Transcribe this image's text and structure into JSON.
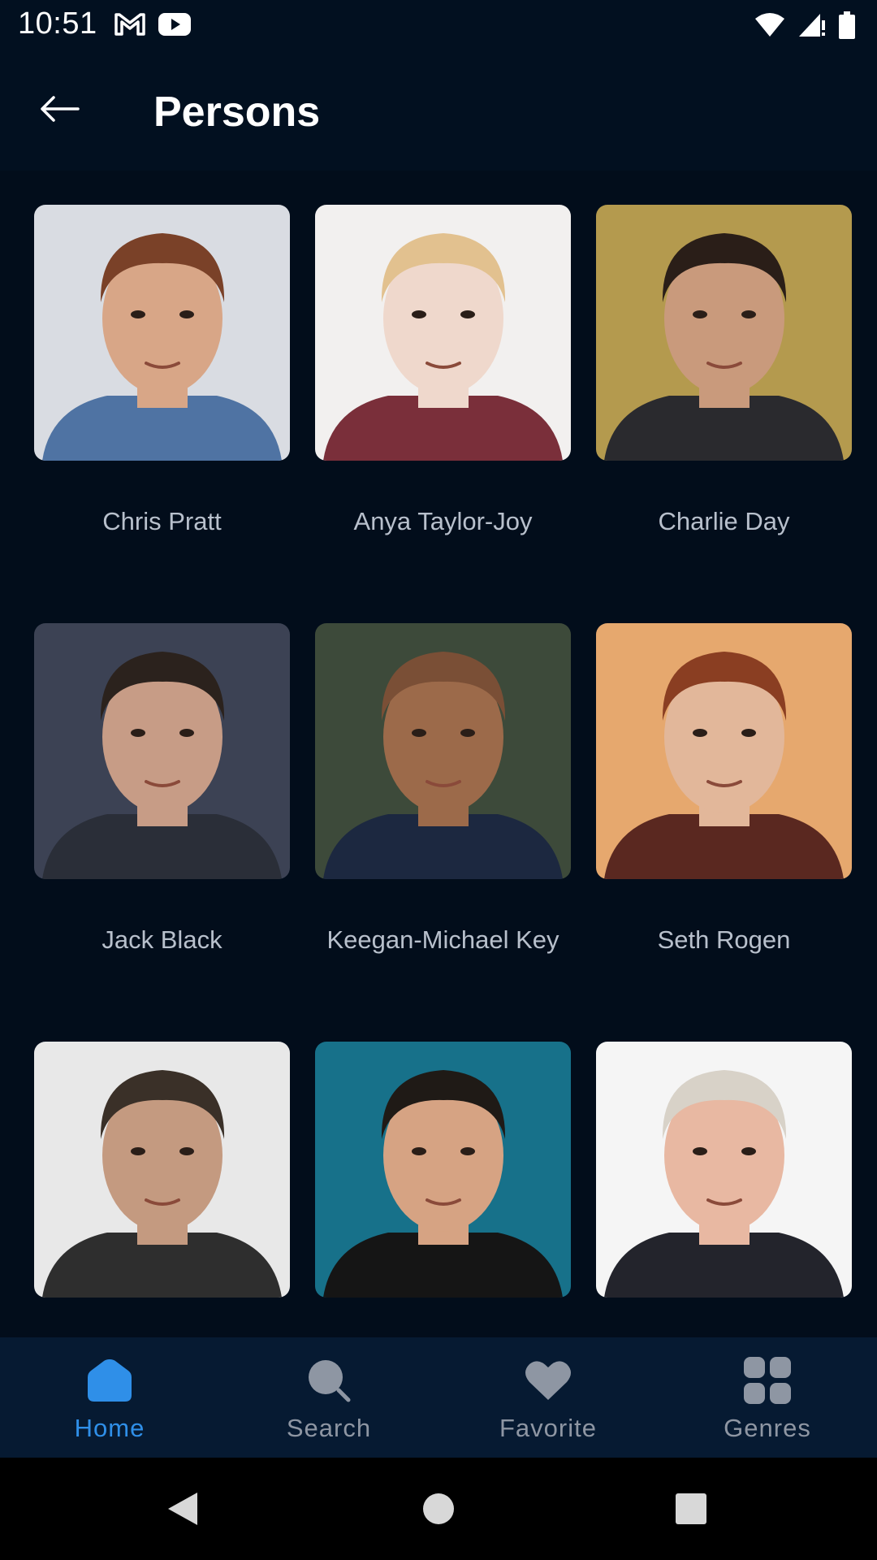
{
  "status_bar": {
    "time": "10:51",
    "left_icons": [
      "gmail-icon",
      "youtube-icon"
    ],
    "right_icons": [
      "wifi-icon",
      "signal-icon",
      "battery-icon"
    ]
  },
  "app_bar": {
    "title": "Persons",
    "back_icon": "arrow-left-icon"
  },
  "persons": [
    {
      "name": "Chris Pratt",
      "bg": "#d9dce2",
      "skin": "#d8a687",
      "hair": "#7a4128",
      "shirt": "#4f73a3"
    },
    {
      "name": "Anya Taylor-Joy",
      "bg": "#f2f0ef",
      "skin": "#efd8cc",
      "hair": "#e2c18f",
      "shirt": "#7a2f3a"
    },
    {
      "name": "Charlie Day",
      "bg": "#b49a4e",
      "skin": "#c99a7c",
      "hair": "#2a1e18",
      "shirt": "#2a2a2e"
    },
    {
      "name": "Jack Black",
      "bg": "#3c4254",
      "skin": "#c79c86",
      "hair": "#2b221d",
      "shirt": "#2a2e38"
    },
    {
      "name": "Keegan-Michael Key",
      "bg": "#3d4a3a",
      "skin": "#9c6a4a",
      "hair": "#7a4f36",
      "shirt": "#1c2840"
    },
    {
      "name": "Seth Rogen",
      "bg": "#e6a86e",
      "skin": "#e2b79a",
      "hair": "#8a3e22",
      "shirt": "#5a2820"
    },
    {
      "name": "",
      "bg": "#e8e8e8",
      "skin": "#c49a80",
      "hair": "#3a3028",
      "shirt": "#2e2e2e"
    },
    {
      "name": "",
      "bg": "#17718a",
      "skin": "#d6a383",
      "hair": "#1f1a16",
      "shirt": "#151515"
    },
    {
      "name": "",
      "bg": "#f5f5f5",
      "skin": "#e8b8a2",
      "hair": "#d8d2c8",
      "shirt": "#23242c"
    }
  ],
  "bottom_nav": [
    {
      "label": "Home",
      "icon": "home-icon",
      "active": true
    },
    {
      "label": "Search",
      "icon": "search-icon",
      "active": false
    },
    {
      "label": "Favorite",
      "icon": "heart-icon",
      "active": false
    },
    {
      "label": "Genres",
      "icon": "grid-icon",
      "active": false
    }
  ],
  "system_nav": [
    "back-triangle-icon",
    "home-circle-icon",
    "recents-square-icon"
  ],
  "colors": {
    "background": "#020d1b",
    "app_bar": "#021020",
    "bottom_nav": "#061a32",
    "accent": "#2f8fe8",
    "inactive": "#8e96a3"
  }
}
